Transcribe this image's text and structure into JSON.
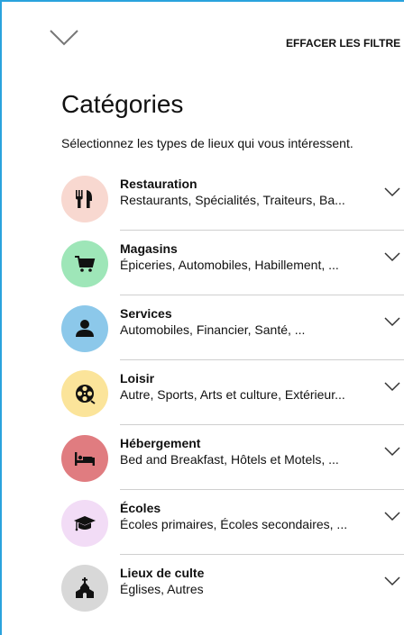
{
  "header": {
    "clear_label": "EFFACER LES FILTRE"
  },
  "page": {
    "title": "Catégories",
    "subtitle": "Sélectionnez les types de lieux qui vous intéressent."
  },
  "categories": [
    {
      "name": "Restauration",
      "description": "Restaurants, Spécialités, Traiteurs, Ba...",
      "color": "#f8d8d0",
      "icon": "utensils-icon"
    },
    {
      "name": "Magasins",
      "description": "Épiceries, Automobiles, Habillement, ...",
      "color": "#9ee6b8",
      "icon": "shopping-cart-icon"
    },
    {
      "name": "Services",
      "description": "Automobiles, Financier, Santé, ...",
      "color": "#8cc8ea",
      "icon": "person-icon"
    },
    {
      "name": "Loisir",
      "description": "Autre, Sports, Arts et culture, Extérieur...",
      "color": "#fbe49a",
      "icon": "film-reel-icon"
    },
    {
      "name": "Hébergement",
      "description": "Bed and Breakfast, Hôtels et Motels, ...",
      "color": "#e07c80",
      "icon": "bed-icon"
    },
    {
      "name": "Écoles",
      "description": "Écoles primaires, Écoles secondaires, ...",
      "color": "#f2dcf6",
      "icon": "graduation-cap-icon"
    },
    {
      "name": "Lieux de culte",
      "description": "Églises, Autres",
      "color": "#d8d8d8",
      "icon": "church-icon"
    }
  ]
}
